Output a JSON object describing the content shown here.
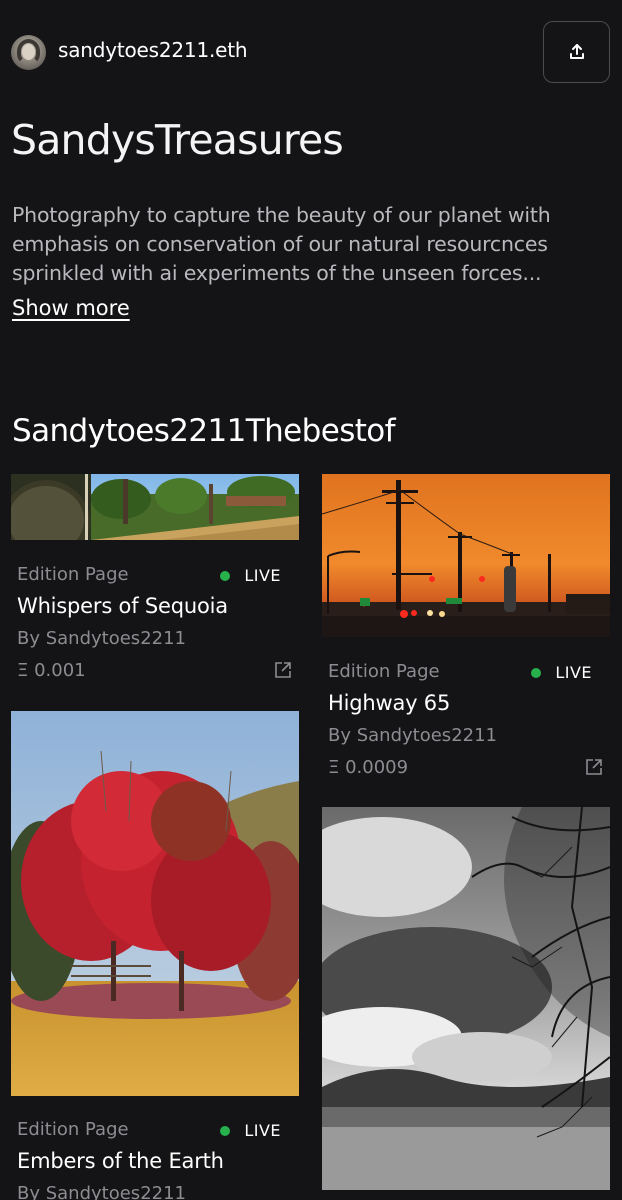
{
  "header": {
    "owner_name": "sandytoes2211.eth",
    "share_icon": "share-upload-icon"
  },
  "collection": {
    "title": "SandysTreasures",
    "description": "Photography to capture the beauty of our planet with emphasis on conservation of our natural resourcnces sprinkled with ai experiments of the unseen forces...",
    "show_more_label": "Show more"
  },
  "section": {
    "title": "Sandytoes2211Thebestof"
  },
  "cards": [
    {
      "kind": "Edition Page",
      "status": "LIVE",
      "name": "Whispers of Sequoia",
      "author": "By Sandytoes2211",
      "price": "Ξ 0.001"
    },
    {
      "kind": "Edition Page",
      "status": "LIVE",
      "name": "Highway 65",
      "author": "By Sandytoes2211",
      "price": "Ξ 0.0009"
    },
    {
      "kind": "Edition Page",
      "status": "LIVE",
      "name": "Embers of the Earth",
      "author": "By Sandytoes2211"
    },
    {}
  ],
  "colors": {
    "background": "#141416",
    "live_dot": "#27b04b",
    "muted_text": "#8c8c91"
  }
}
